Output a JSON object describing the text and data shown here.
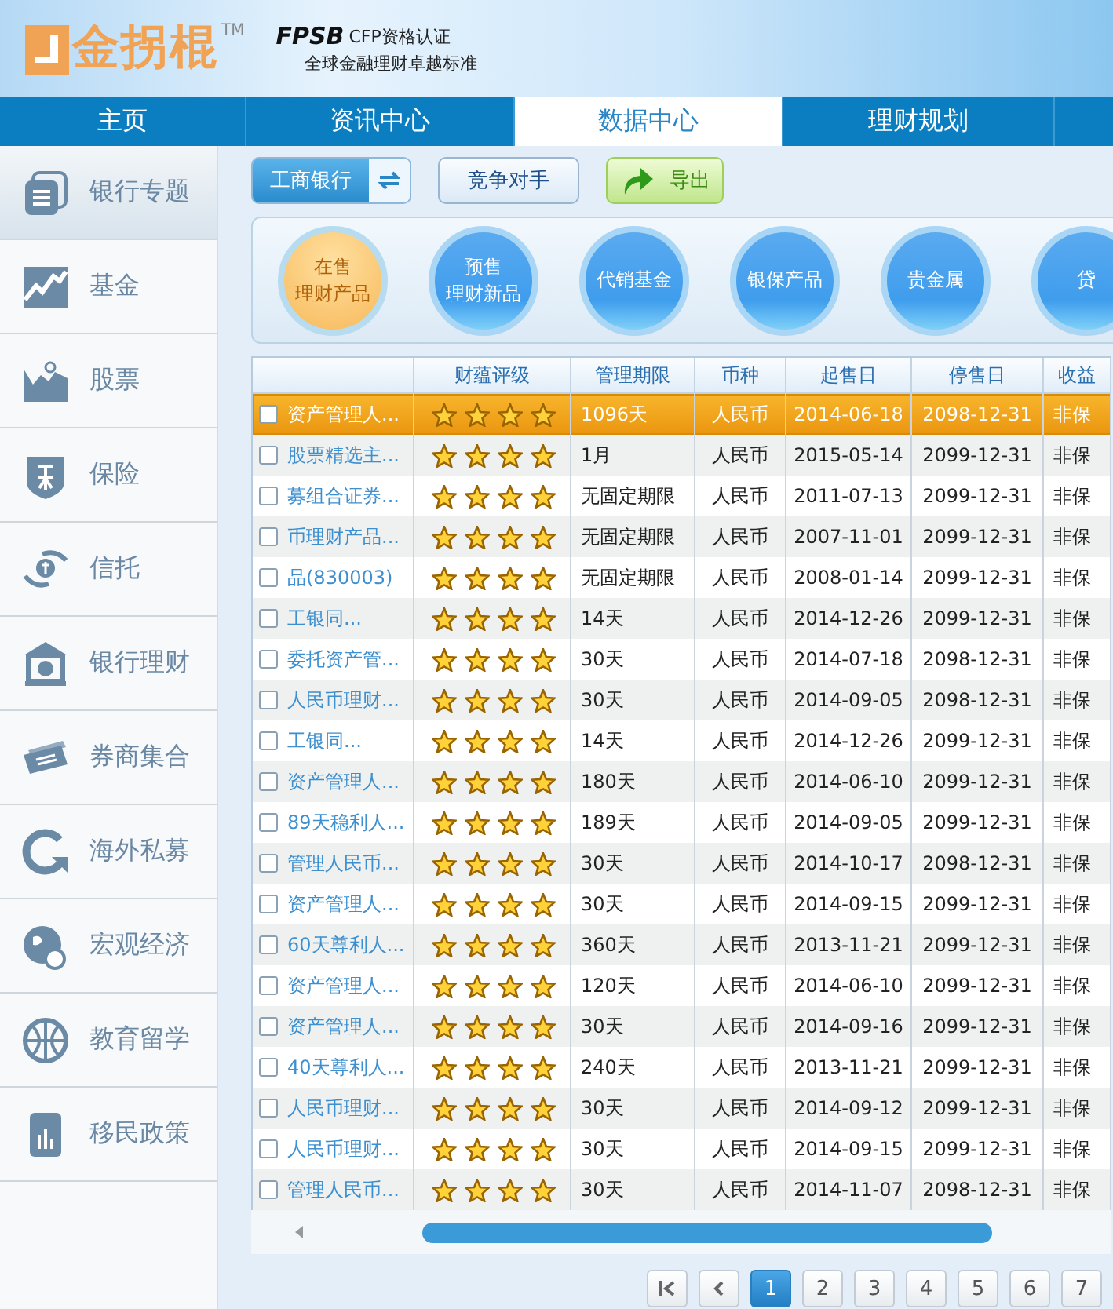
{
  "header": {
    "logo_text": "金拐棍",
    "trademark": "TM",
    "partner_logo": "FPSB",
    "partner_title": "CFP资格认证",
    "partner_slogan": "全球金融理财卓越标准"
  },
  "nav": [
    {
      "label": "主页",
      "selected": false
    },
    {
      "label": "资讯中心",
      "selected": false
    },
    {
      "label": "数据中心",
      "selected": true
    },
    {
      "label": "理财规划",
      "selected": false
    }
  ],
  "sidebar": [
    {
      "label": "银行专题",
      "selected": true
    },
    {
      "label": "基金",
      "selected": false
    },
    {
      "label": "股票",
      "selected": false
    },
    {
      "label": "保险",
      "selected": false
    },
    {
      "label": "信托",
      "selected": false
    },
    {
      "label": "银行理财",
      "selected": false
    },
    {
      "label": "券商集合",
      "selected": false
    },
    {
      "label": "海外私募",
      "selected": false
    },
    {
      "label": "宏观经济",
      "selected": false
    },
    {
      "label": "教育留学",
      "selected": false
    },
    {
      "label": "移民政策",
      "selected": false
    }
  ],
  "toolbar": {
    "bank": "工商银行",
    "competitor": "竞争对手",
    "export": "导出"
  },
  "categories": [
    {
      "lines": [
        "在售",
        "理财产品"
      ],
      "selected": true
    },
    {
      "lines": [
        "预售",
        "理财新品"
      ],
      "selected": false
    },
    {
      "lines": [
        "代销基金"
      ],
      "selected": false
    },
    {
      "lines": [
        "银保产品"
      ],
      "selected": false
    },
    {
      "lines": [
        "贵金属"
      ],
      "selected": false
    },
    {
      "lines": [
        "贷"
      ],
      "selected": false
    }
  ],
  "table": {
    "columns": [
      "财蕴评级",
      "管理期限",
      "币种",
      "起售日",
      "停售日",
      "收益"
    ],
    "rows": [
      {
        "name": "资产管理人...",
        "stars": 4,
        "period": "1096天",
        "currency": "人民币",
        "start": "2014-06-18",
        "end": "2098-12-31",
        "type": "非保",
        "selected": true,
        "checked": false
      },
      {
        "name": "股票精选主...",
        "stars": 4,
        "period": "1月",
        "currency": "人民币",
        "start": "2015-05-14",
        "end": "2099-12-31",
        "type": "非保",
        "selected": false,
        "checked": false
      },
      {
        "name": "募组合证券...",
        "stars": 4,
        "period": "无固定期限",
        "currency": "人民币",
        "start": "2011-07-13",
        "end": "2099-12-31",
        "type": "非保",
        "selected": false,
        "checked": false
      },
      {
        "name": "币理财产品...",
        "stars": 4,
        "period": "无固定期限",
        "currency": "人民币",
        "start": "2007-11-01",
        "end": "2099-12-31",
        "type": "非保",
        "selected": false,
        "checked": false
      },
      {
        "name": "品(830003)",
        "stars": 4,
        "period": "无固定期限",
        "currency": "人民币",
        "start": "2008-01-14",
        "end": "2099-12-31",
        "type": "非保",
        "selected": false,
        "checked": false
      },
      {
        "name": "工银同...",
        "stars": 4,
        "period": "14天",
        "currency": "人民币",
        "start": "2014-12-26",
        "end": "2099-12-31",
        "type": "非保",
        "selected": false,
        "checked": false
      },
      {
        "name": "委托资产管...",
        "stars": 4,
        "period": "30天",
        "currency": "人民币",
        "start": "2014-07-18",
        "end": "2098-12-31",
        "type": "非保",
        "selected": false,
        "checked": false
      },
      {
        "name": "人民币理财...",
        "stars": 4,
        "period": "30天",
        "currency": "人民币",
        "start": "2014-09-05",
        "end": "2098-12-31",
        "type": "非保",
        "selected": false,
        "checked": false
      },
      {
        "name": "工银同...",
        "stars": 4,
        "period": "14天",
        "currency": "人民币",
        "start": "2014-12-26",
        "end": "2099-12-31",
        "type": "非保",
        "selected": false,
        "checked": false
      },
      {
        "name": "资产管理人...",
        "stars": 4,
        "period": "180天",
        "currency": "人民币",
        "start": "2014-06-10",
        "end": "2099-12-31",
        "type": "非保",
        "selected": false,
        "checked": false
      },
      {
        "name": "89天稳利人...",
        "stars": 4,
        "period": "189天",
        "currency": "人民币",
        "start": "2014-09-05",
        "end": "2099-12-31",
        "type": "非保",
        "selected": false,
        "checked": false
      },
      {
        "name": "管理人民币...",
        "stars": 4,
        "period": "30天",
        "currency": "人民币",
        "start": "2014-10-17",
        "end": "2098-12-31",
        "type": "非保",
        "selected": false,
        "checked": false
      },
      {
        "name": "资产管理人...",
        "stars": 4,
        "period": "30天",
        "currency": "人民币",
        "start": "2014-09-15",
        "end": "2099-12-31",
        "type": "非保",
        "selected": false,
        "checked": false
      },
      {
        "name": "60天尊利人...",
        "stars": 4,
        "period": "360天",
        "currency": "人民币",
        "start": "2013-11-21",
        "end": "2099-12-31",
        "type": "非保",
        "selected": false,
        "checked": false
      },
      {
        "name": "资产管理人...",
        "stars": 4,
        "period": "120天",
        "currency": "人民币",
        "start": "2014-06-10",
        "end": "2099-12-31",
        "type": "非保",
        "selected": false,
        "checked": false
      },
      {
        "name": "资产管理人...",
        "stars": 4,
        "period": "30天",
        "currency": "人民币",
        "start": "2014-09-16",
        "end": "2099-12-31",
        "type": "非保",
        "selected": false,
        "checked": false
      },
      {
        "name": "40天尊利人...",
        "stars": 4,
        "period": "240天",
        "currency": "人民币",
        "start": "2013-11-21",
        "end": "2099-12-31",
        "type": "非保",
        "selected": false,
        "checked": false
      },
      {
        "name": "人民币理财...",
        "stars": 4,
        "period": "30天",
        "currency": "人民币",
        "start": "2014-09-12",
        "end": "2099-12-31",
        "type": "非保",
        "selected": false,
        "checked": false
      },
      {
        "name": "人民币理财...",
        "stars": 4,
        "period": "30天",
        "currency": "人民币",
        "start": "2014-09-15",
        "end": "2099-12-31",
        "type": "非保",
        "selected": false,
        "checked": false
      },
      {
        "name": "管理人民币...",
        "stars": 4,
        "period": "30天",
        "currency": "人民币",
        "start": "2014-11-07",
        "end": "2098-12-31",
        "type": "非保",
        "selected": false,
        "checked": false
      }
    ]
  },
  "pagination": {
    "pages": [
      {
        "label": "1",
        "selected": true
      },
      {
        "label": "2",
        "selected": false
      },
      {
        "label": "3",
        "selected": false
      },
      {
        "label": "4",
        "selected": false
      },
      {
        "label": "5",
        "selected": false
      },
      {
        "label": "6",
        "selected": false
      },
      {
        "label": "7",
        "selected": false
      }
    ]
  }
}
